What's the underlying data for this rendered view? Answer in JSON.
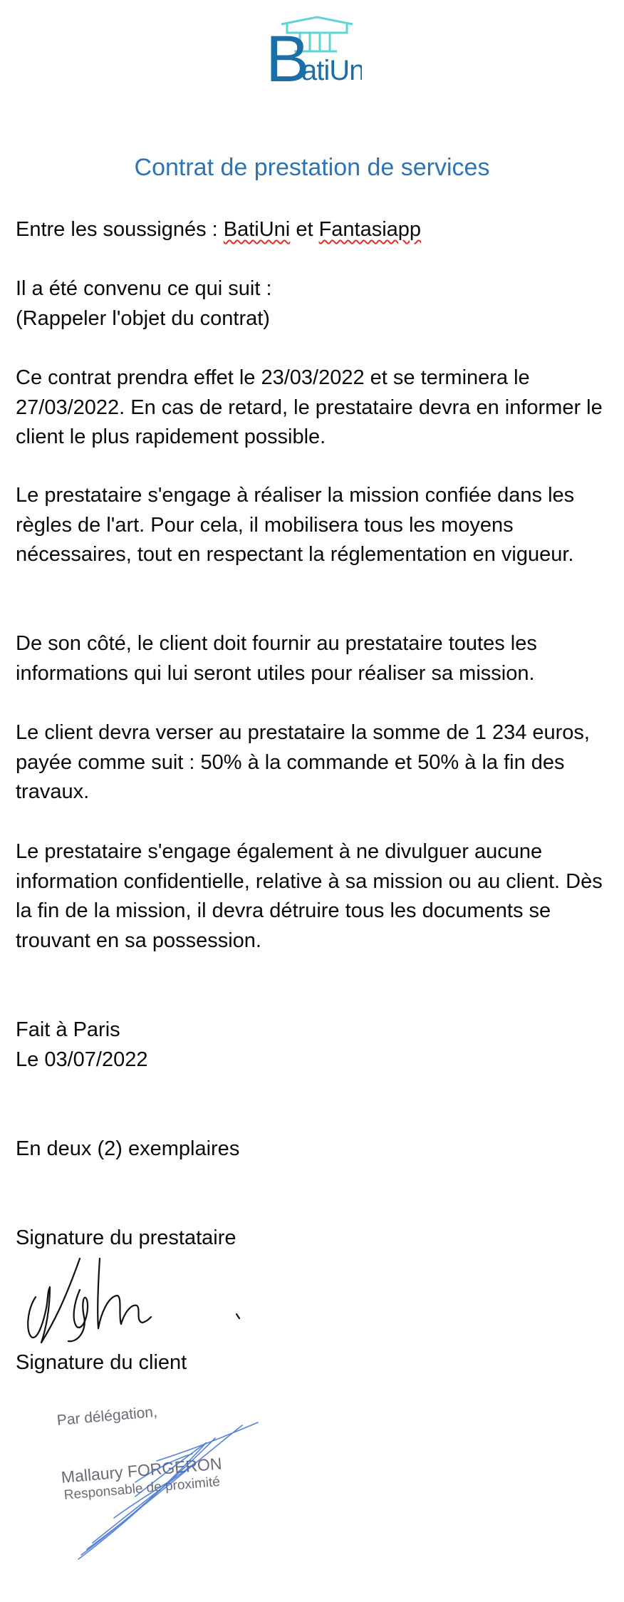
{
  "logo": {
    "text": "BatiUni",
    "color": "#1b6fa8",
    "accent_color": "#5fd3d6"
  },
  "title": "Contrat de prestation de services",
  "intro": {
    "prefix": "Entre les soussignés : ",
    "party1": "BatiUni",
    "conjunction": " et ",
    "party2": "Fantasiapp"
  },
  "agreement": {
    "line1": "Il a été convenu ce qui suit :",
    "line2": "(Rappeler l'objet du contrat)"
  },
  "paragraphs": {
    "dates": "Ce contrat prendra effet le 23/03/2022 et se terminera le 27/03/2022. En cas de retard, le prestataire devra en informer le client le plus rapidement possible.",
    "engagement": "Le prestataire s'engage à réaliser la mission confiée dans les règles de l'art. Pour cela, il mobilisera tous les moyens nécessaires, tout en respectant la réglementation en vigueur.",
    "client_duty": "De son côté, le client doit fournir au prestataire toutes les informations qui lui seront utiles pour réaliser sa mission.",
    "payment": "Le client devra verser au prestataire la somme de 1 234 euros, payée comme suit : 50% à la commande et 50% à la fin des travaux.",
    "confidentiality": "Le prestataire s'engage également à ne divulguer aucune information confidentielle, relative à sa mission ou au client. Dès la fin de la mission, il devra détruire tous les documents se trouvant en sa possession."
  },
  "place": "Fait à Paris",
  "date": "Le 03/07/2022",
  "copies": "En deux (2) exemplaires",
  "signature_prestataire_label": "Signature du prestataire",
  "signature_client_label": "Signature du client",
  "stamp": {
    "line1": "Par délégation,",
    "name": "Mallaury FORGERON",
    "role": "Responsable de proximité"
  }
}
